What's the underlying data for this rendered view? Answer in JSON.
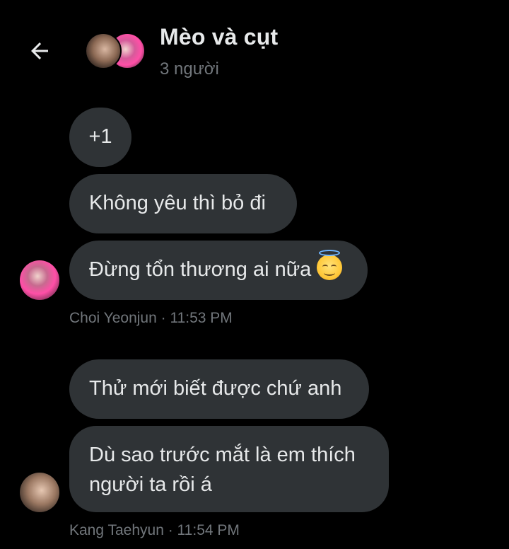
{
  "header": {
    "title": "Mèo và cụt",
    "subtitle": "3 người",
    "back_icon": "arrow-left-icon"
  },
  "messages": [
    {
      "text": "+1"
    },
    {
      "text": "Không yêu thì bỏ đi"
    },
    {
      "text": "Đừng tổn thương ai nữa",
      "emoji": "smiling-face-with-halo-icon"
    },
    {
      "text": "Thử mới biết được chứ anh"
    },
    {
      "text": "Dù sao trước mắt là em thích người ta rồi á"
    }
  ],
  "meta": [
    {
      "text": "Choi Yeonjun · 11:53 PM"
    },
    {
      "text": "Kang Taehyun · 11:54 PM"
    }
  ],
  "colors": {
    "background": "#000000",
    "bubble": "#2f3336",
    "text": "#e7e9ea",
    "secondary_text": "#71767b"
  }
}
